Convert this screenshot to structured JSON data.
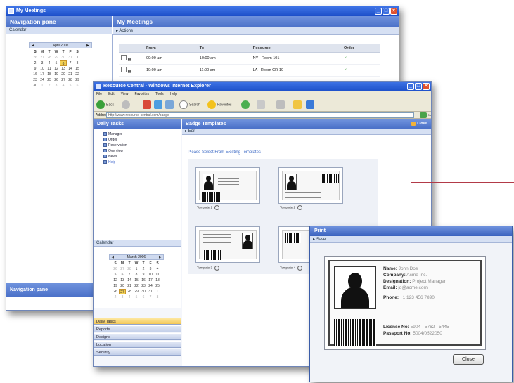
{
  "meetings_window": {
    "title": "My Meetings",
    "nav_header": "Navigation pane",
    "calendar_label": "Calendar",
    "month_label": "April 2006",
    "weekday_headers": [
      "S",
      "M",
      "T",
      "W",
      "T",
      "F",
      "S"
    ],
    "calendar_days": [
      "26",
      "27",
      "28",
      "29",
      "30",
      "31",
      "1",
      "2",
      "3",
      "4",
      "5",
      "6",
      "7",
      "8",
      "9",
      "10",
      "11",
      "12",
      "13",
      "14",
      "15",
      "16",
      "17",
      "18",
      "19",
      "20",
      "21",
      "22",
      "23",
      "24",
      "25",
      "26",
      "27",
      "28",
      "29",
      "30",
      "1",
      "2",
      "3",
      "4",
      "5",
      "6"
    ],
    "selected_day": "6",
    "main_header": "My Meetings",
    "toolbar_label": "Actions",
    "table_headers": [
      "From",
      "To",
      "Resource",
      "Order"
    ],
    "rows": [
      {
        "from": "09:00 am",
        "to": "10:00 am",
        "resource": "NY - Room 101",
        "order": "✓"
      },
      {
        "from": "10:00 am",
        "to": "11:00 am",
        "resource": "LA - Room CR-10",
        "order": "✓"
      }
    ],
    "footer": "Navigation pane"
  },
  "browser_window": {
    "title": "Resource Central - Windows Internet Explorer",
    "menu": [
      "File",
      "Edit",
      "View",
      "Favorites",
      "Tools",
      "Help"
    ],
    "toolbar": {
      "back": "Back",
      "search": "Search",
      "favorites": "Favorites"
    },
    "address_label": "Address",
    "address_value": "http://www.resource-central.com/badge",
    "go_label": "Go",
    "left_header": "Daily Tasks",
    "tree_items": [
      "Manager",
      "Order",
      "Reservation",
      "Overview",
      "News",
      "Help"
    ],
    "calendar_label": "Calendar",
    "month_label": "March 2006",
    "calendar_days": [
      "26",
      "27",
      "28",
      "1",
      "2",
      "3",
      "4",
      "5",
      "6",
      "7",
      "8",
      "9",
      "10",
      "11",
      "12",
      "13",
      "14",
      "15",
      "16",
      "17",
      "18",
      "19",
      "20",
      "21",
      "22",
      "23",
      "24",
      "25",
      "26",
      "27",
      "28",
      "29",
      "30",
      "31",
      "1",
      "2",
      "3",
      "4",
      "5",
      "6",
      "7",
      "8"
    ],
    "selected_day": "27",
    "accordion": [
      "Daily Tasks",
      "Reports",
      "Designs",
      "Location",
      "Security"
    ],
    "right_header": "Badge Templates",
    "close_label": "Close",
    "sub_toolbar": "Edit",
    "instruction": "Please Select From Existing Templates",
    "templates": [
      "Template 1",
      "Template 2",
      "Template 3",
      "Template 4"
    ]
  },
  "preview_window": {
    "title": "Print",
    "sub_toolbar": "Save",
    "fields": [
      {
        "label": "Name:",
        "value": "John Doe"
      },
      {
        "label": "Company:",
        "value": "Acme Inc."
      },
      {
        "label": "Designation:",
        "value": "Project Manager"
      },
      {
        "label": "Email:",
        "value": "jd@acme.com"
      },
      {
        "label": "Phone:",
        "value": "+1 123 456 7890"
      }
    ],
    "id_fields": [
      {
        "label": "License No:",
        "value": "5904 - 5762 - 5445"
      },
      {
        "label": "Passport No:",
        "value": "5004/0522050"
      }
    ],
    "close_button": "Close"
  },
  "colors": {
    "title_blue": "#1c4fc9",
    "pane_header": "#4a70c8",
    "accent_line": "#b23a48",
    "selected_day": "#f2cf52"
  }
}
